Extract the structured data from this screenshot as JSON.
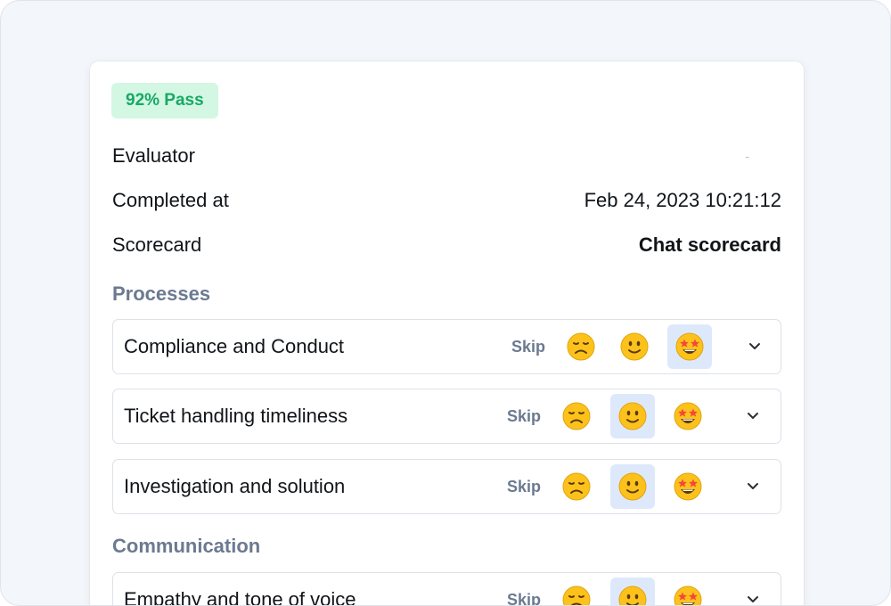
{
  "badge": {
    "label": "92% Pass"
  },
  "meta": {
    "evaluator": {
      "label": "Evaluator",
      "value": "-"
    },
    "completed": {
      "label": "Completed at",
      "value": "Feb 24, 2023 10:21:12"
    },
    "scorecard": {
      "label": "Scorecard",
      "value": "Chat scorecard"
    }
  },
  "sections": [
    {
      "title": "Processes",
      "items": [
        {
          "name": "Compliance and Conduct",
          "skip_label": "Skip",
          "options": [
            "sad-face-icon",
            "smile-face-icon",
            "star-eyes-face-icon"
          ],
          "selected": "star-eyes-face-icon"
        },
        {
          "name": "Ticket handling timeliness",
          "skip_label": "Skip",
          "options": [
            "sad-face-icon",
            "smile-face-icon",
            "star-eyes-face-icon"
          ],
          "selected": "smile-face-icon"
        },
        {
          "name": "Investigation and solution",
          "skip_label": "Skip",
          "options": [
            "sad-face-icon",
            "smile-face-icon",
            "star-eyes-face-icon"
          ],
          "selected": "smile-face-icon"
        }
      ]
    },
    {
      "title": "Communication",
      "items": [
        {
          "name": "Empathy and tone of voice",
          "skip_label": "Skip",
          "options": [
            "sad-face-icon",
            "smile-face-icon",
            "star-eyes-face-icon"
          ],
          "selected": "smile-face-icon"
        }
      ]
    }
  ],
  "colors": {
    "badge_bg": "#d3f7e3",
    "badge_text": "#19a866",
    "section_title": "#6b7a90",
    "selected_bg": "#dde9fb",
    "emoji_yellow": "#fcc21b"
  }
}
